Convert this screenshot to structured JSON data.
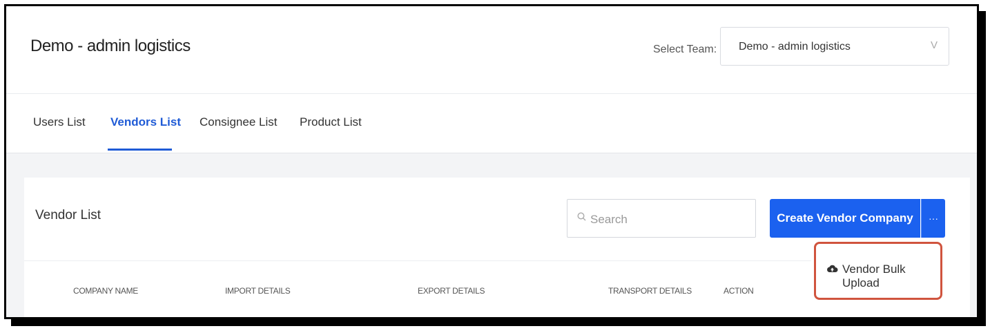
{
  "header": {
    "title": "Demo - admin logistics",
    "team_label": "Select Team:",
    "team_value": "Demo - admin logistics",
    "chevron": "V"
  },
  "tabs": [
    {
      "label": "Users List",
      "active": false
    },
    {
      "label": "Vendors List",
      "active": true
    },
    {
      "label": "Consignee List",
      "active": false
    },
    {
      "label": "Product List",
      "active": false
    }
  ],
  "card": {
    "title": "Vendor List",
    "search_placeholder": "Search",
    "create_button": "Create Vendor Company",
    "more_button": "···",
    "dropdown_item": "Vendor Bulk Upload",
    "columns": [
      "COMPANY NAME",
      "IMPORT DETAILS",
      "EXPORT DETAILS",
      "TRANSPORT DETAILS",
      "ACTION"
    ]
  },
  "colors": {
    "accent": "#1b61ef",
    "active_tab": "#1f5bd6",
    "highlight_border": "#d0543e"
  },
  "icons": {
    "search": "search-icon",
    "upload": "cloud-upload-icon",
    "chevron": "chevron-down-icon"
  }
}
